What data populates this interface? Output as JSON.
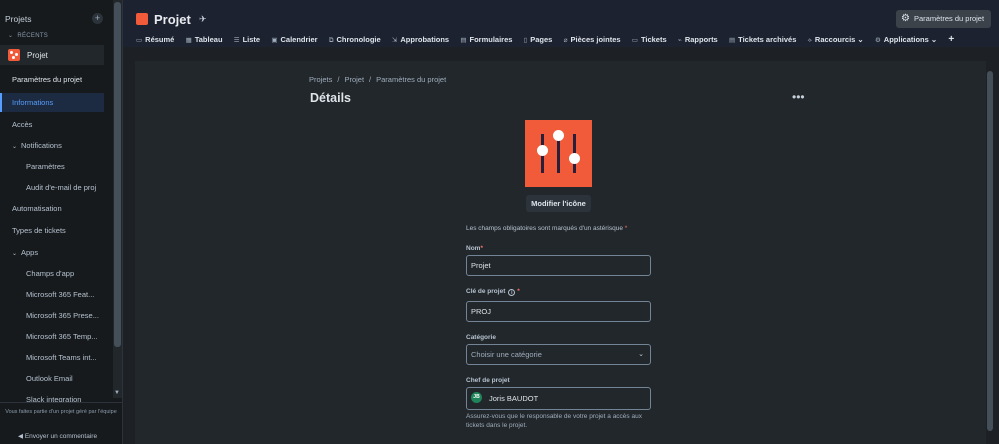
{
  "sidebar": {
    "header": "Projets",
    "add_label": "+",
    "recents_label": "RÉCENTS",
    "project_label": "Projet",
    "items": [
      {
        "label": "Paramètres du projet"
      },
      {
        "label": "Informations"
      },
      {
        "label": "Accès"
      },
      {
        "label": "Notifications"
      },
      {
        "label": "Paramètres"
      },
      {
        "label": "Audit d'e-mail de proj"
      },
      {
        "label": "Automatisation"
      },
      {
        "label": "Types de tickets"
      },
      {
        "label": "Apps"
      },
      {
        "label": "Champs d'app"
      },
      {
        "label": "Microsoft 365 Feat..."
      },
      {
        "label": "Microsoft 365 Prese..."
      },
      {
        "label": "Microsoft 365 Temp..."
      },
      {
        "label": "Microsoft Teams int..."
      },
      {
        "label": "Outlook Email"
      },
      {
        "label": "Slack integration"
      }
    ],
    "footer_text": "Vous faites partie d'un projet géré par l'équipe",
    "feedback_label": "Envoyer un commentaire"
  },
  "header": {
    "title": "Projet",
    "settings_button": "Paramètres du projet",
    "tabs": [
      {
        "label": "Résumé",
        "icon": "▭"
      },
      {
        "label": "Tableau",
        "icon": "▦"
      },
      {
        "label": "Liste",
        "icon": "☰"
      },
      {
        "label": "Calendrier",
        "icon": "▣"
      },
      {
        "label": "Chronologie",
        "icon": "⧉"
      },
      {
        "label": "Approbations",
        "icon": "⇲"
      },
      {
        "label": "Formulaires",
        "icon": "▤"
      },
      {
        "label": "Pages",
        "icon": "▯"
      },
      {
        "label": "Pièces jointes",
        "icon": "⌀"
      },
      {
        "label": "Tickets",
        "icon": "▭"
      },
      {
        "label": "Rapports",
        "icon": "⌁"
      },
      {
        "label": "Tickets archivés",
        "icon": "▤"
      },
      {
        "label": "Raccourcis ⌄",
        "icon": "⟡"
      },
      {
        "label": "Applications ⌄",
        "icon": "⚙"
      }
    ],
    "add_tab_label": "+"
  },
  "content": {
    "breadcrumb": [
      "Projets",
      "Projet",
      "Paramètres du projet"
    ],
    "breadcrumb_sep": "/",
    "title": "Détails",
    "more_label": "•••",
    "edit_icon_button": "Modifier l'icône",
    "required_note": "Les champs obligatoires sont marqués d'un astérisque",
    "asterisk": "*",
    "fields": {
      "name_label": "Nom",
      "name_value": "Projet",
      "key_label": "Clé de projet",
      "key_value": "PROJ",
      "category_label": "Catégorie",
      "category_placeholder": "Choisir une catégorie",
      "lead_label": "Chef de projet",
      "lead_initials": "JB",
      "lead_name": "Joris BAUDOT"
    },
    "lead_help": "Assurez-vous que le responsable de votre projet a accès aux tickets dans le projet."
  },
  "colors": {
    "accent": "#579dff",
    "project_icon": "#f15b3a",
    "background": "#1d2125",
    "avatar": "#1f845a"
  }
}
